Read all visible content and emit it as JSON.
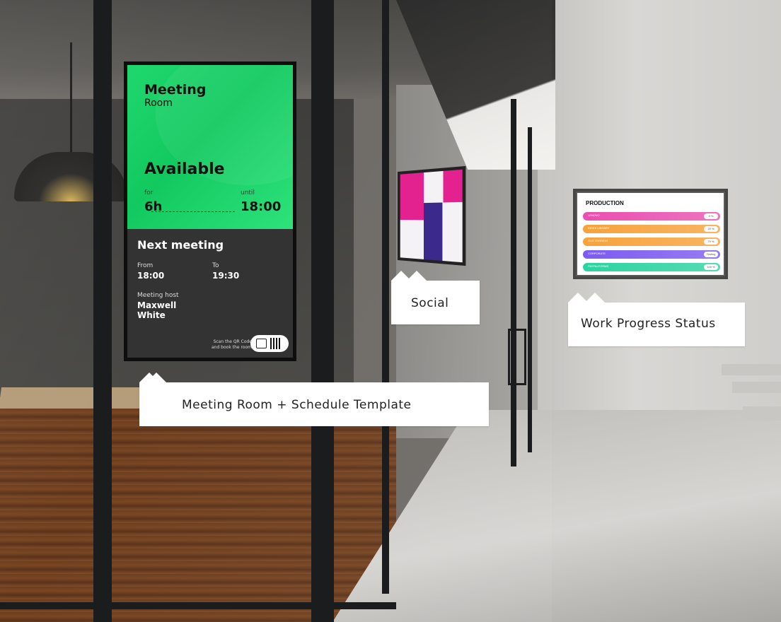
{
  "meeting_screen": {
    "title": "Meeting",
    "subtitle": "Room",
    "status": "Available",
    "for_label": "for",
    "for_value": "6h",
    "until_label": "until",
    "until_value": "18:00",
    "next_heading": "Next meeting",
    "from_label": "From",
    "from_value": "18:00",
    "to_label": "To",
    "to_value": "19:30",
    "host_label": "Meeting host",
    "host_first": "Maxwell",
    "host_last": "White",
    "qr_hint_line1": "Scan the QR Code",
    "qr_hint_line2": "and book the room",
    "colors": {
      "available": "#1fd86d",
      "panel": "#333333"
    }
  },
  "production_screen": {
    "title": "PRODUCTION",
    "rows": [
      {
        "label": "LENOVO",
        "value": "5 %",
        "color": "#e94fb0"
      },
      {
        "label": "INDEX LIBRARY",
        "value": "20 %",
        "color": "#f7a23b"
      },
      {
        "label": "GUS TORRENT",
        "value": "70 %",
        "color": "#f7a23b"
      },
      {
        "label": "CORPORATE",
        "value": "Testing",
        "color": "#7b5cf0"
      },
      {
        "label": "PAYPALFORMS",
        "value": "100 %",
        "color": "#2bd3a0"
      }
    ]
  },
  "callouts": {
    "meeting": "Meeting Room + Schedule Template",
    "social": "Social",
    "work": "Work Progress Status"
  }
}
